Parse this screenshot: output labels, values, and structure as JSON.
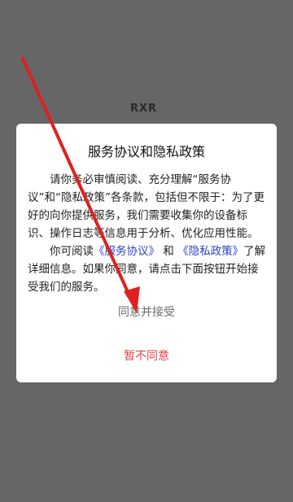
{
  "logo": {
    "text": "RXR"
  },
  "dialog": {
    "title": "服务协议和隐私政策",
    "paragraph1": "请你务必审慎阅读、充分理解“服务协议”和“隐私政策”各条款，包括但不限于：为了更好的向你提供服务，我们需要收集你的设备标识、操作日志等信息用于分析、优化应用性能。",
    "paragraph2_prefix": "你可阅读",
    "service_agreement_link": "《服务协议》",
    "paragraph2_and": "和",
    "privacy_policy_link": "《隐私政策》",
    "paragraph2_suffix": "了解详细信息。如果你同意，请点击下面按钮开始接受我们的服务。",
    "agree_label": "同意并接受",
    "disagree_label": "暂不同意"
  },
  "colors": {
    "overlay": "#666666",
    "link": "#2a43c9",
    "disagree": "#e0424a",
    "annotation_arrow": "#e02020"
  }
}
